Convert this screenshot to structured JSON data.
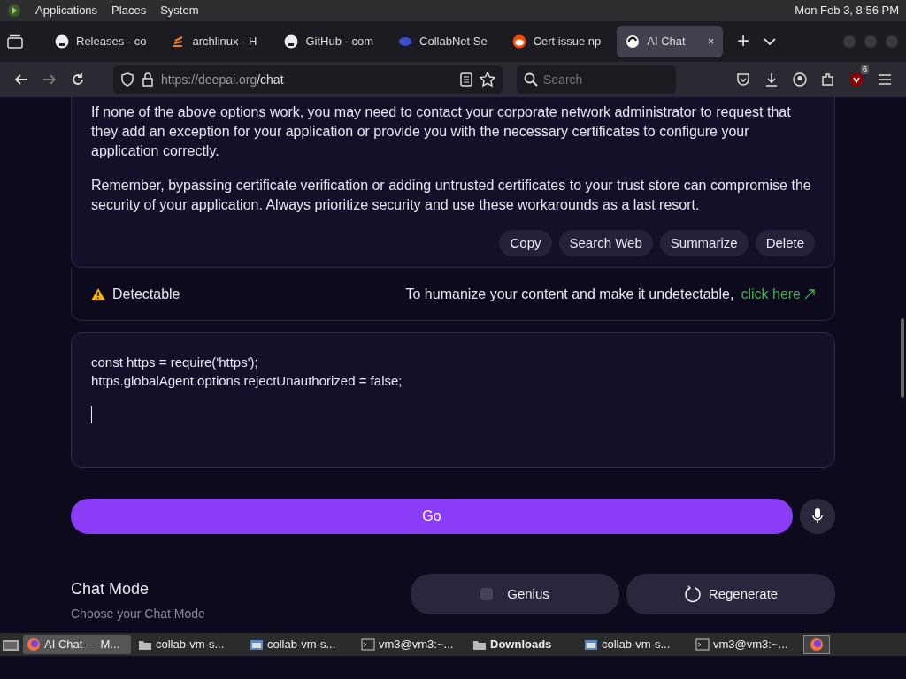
{
  "top_panel": {
    "menus": [
      "Applications",
      "Places",
      "System"
    ],
    "clock": "Mon Feb  3,  8:56 PM"
  },
  "tabs": [
    {
      "label": "Releases · co",
      "selected": false
    },
    {
      "label": "archlinux - H",
      "selected": false
    },
    {
      "label": "GitHub - com",
      "selected": false
    },
    {
      "label": "CollabNet Se",
      "selected": false
    },
    {
      "label": "Cert issue np",
      "selected": false
    },
    {
      "label": "AI Chat",
      "selected": true,
      "close": "×"
    }
  ],
  "new_tab": "+",
  "address": {
    "host": "https://deepai.org",
    "path": "/chat"
  },
  "search": {
    "placeholder": "Search"
  },
  "extension_badge": "6",
  "answer": {
    "paragraphs": [
      "If none of the above options work, you may need to contact your corporate network administrator to request that they add an exception for your application or provide you with the necessary certificates to configure your application correctly.",
      "Remember, bypassing certificate verification or adding untrusted certificates to your trust store can compromise the security of your application. Always prioritize security and use these workarounds as a last resort."
    ],
    "actions": [
      "Copy",
      "Search Web",
      "Summarize",
      "Delete"
    ]
  },
  "detector": {
    "status": "Detectable",
    "prompt": "To humanize your content and make it undetectable,",
    "link": "click here"
  },
  "input": {
    "lines": [
      "const https = require('https');",
      "https.globalAgent.options.rejectUnauthorized = false;"
    ]
  },
  "go_button": "Go",
  "chat_mode": {
    "title": "Chat Mode",
    "subtitle": "Choose your Chat Mode",
    "mode": "Genius",
    "regenerate": "Regenerate"
  },
  "taskbar": [
    {
      "label": "AI Chat — M...",
      "selected": true,
      "bold": false
    },
    {
      "label": "collab-vm-s...",
      "selected": false,
      "bold": false
    },
    {
      "label": "collab-vm-s...",
      "selected": false,
      "bold": false
    },
    {
      "label": "vm3@vm3:~...",
      "selected": false,
      "bold": false
    },
    {
      "label": "Downloads",
      "selected": false,
      "bold": true
    },
    {
      "label": "collab-vm-s...",
      "selected": false,
      "bold": false
    },
    {
      "label": "vm3@vm3:~...",
      "selected": false,
      "bold": false
    }
  ]
}
